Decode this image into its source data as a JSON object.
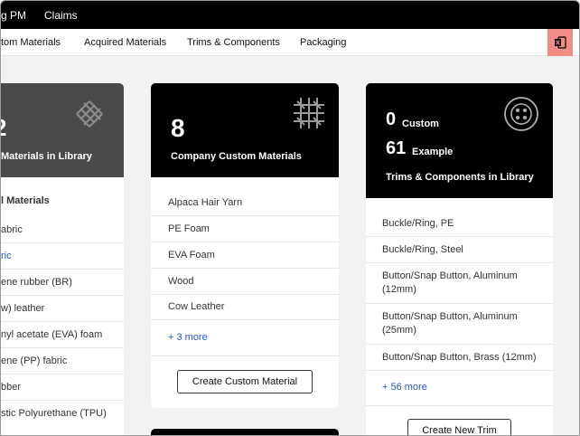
{
  "topnav": {
    "item1": "g PM",
    "item2": "Claims"
  },
  "subnav": {
    "tab1": "tom Materials",
    "tab2": "Acquired Materials",
    "tab3": "Trims & Components",
    "tab4": "Packaging"
  },
  "card_left": {
    "count": "2",
    "subtitle": "Materials in Library",
    "section_title": "l Materials",
    "items": [
      "abric",
      "ric",
      "ene rubber (BR)",
      "w) leather",
      "nyl acetate (EVA) foam",
      "ene (PP) fabric",
      "bber",
      "stic Polyurethane (TPU)"
    ]
  },
  "card_mid": {
    "count": "8",
    "subtitle": "Company Custom Materials",
    "items": [
      "Alpaca Hair Yarn",
      "PE Foam",
      "EVA Foam",
      "Wood",
      "Cow Leather"
    ],
    "more": "+ 3 more",
    "button": "Create Custom Material"
  },
  "card_right": {
    "custom_count": "0",
    "custom_label": "Custom",
    "example_count": "61",
    "example_label": "Example",
    "subtitle": "Trims & Components in Library",
    "items": [
      "Buckle/Ring, PE",
      "Buckle/Ring, Steel",
      "Button/Snap Button, Aluminum (12mm)",
      "Button/Snap Button, Aluminum (25mm)",
      "Button/Snap Button, Brass (12mm)"
    ],
    "more": "+ 56 more",
    "button": "Create New Trim"
  },
  "colors": {
    "link": "#2456c8",
    "excel_button": "#ef8d86",
    "header_dark": "#000000",
    "header_gray": "#4a4a4a"
  }
}
